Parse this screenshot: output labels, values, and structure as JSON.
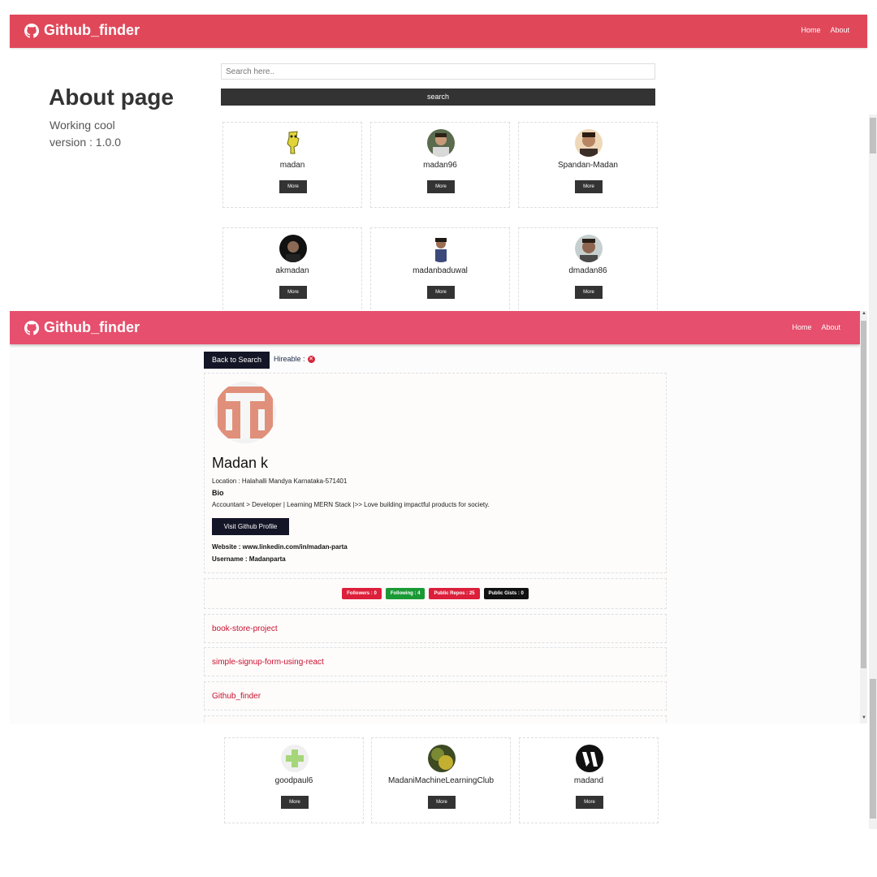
{
  "background_page": {
    "nav": {
      "brand": "Github_finder",
      "links": [
        "Home",
        "About"
      ]
    },
    "about": {
      "title": "About page",
      "line1": "Working cool",
      "line2": "version : 1.0.0"
    },
    "search": {
      "placeholder": "Search here..",
      "button": "search"
    },
    "users": [
      {
        "login": "madan",
        "more": "More"
      },
      {
        "login": "madan96",
        "more": "More"
      },
      {
        "login": "Spandan-Madan",
        "more": "More"
      },
      {
        "login": "akmadan",
        "more": "More"
      },
      {
        "login": "madanbaduwal",
        "more": "More"
      },
      {
        "login": "dmadan86",
        "more": "More"
      },
      {
        "login": "goodpaul6",
        "more": "More"
      },
      {
        "login": "MadaniMachineLearningClub",
        "more": "More"
      },
      {
        "login": "madand",
        "more": "More"
      }
    ]
  },
  "overlay_page": {
    "nav": {
      "brand": "Github_finder",
      "links": [
        "Home",
        "About"
      ]
    },
    "back_button": "Back to Search",
    "hireable": "Hireable :",
    "profile": {
      "name": "Madan k",
      "location": "Location : Halahalli Mandya Karnataka-571401",
      "bio_title": "Bio",
      "bio": "Accountant > Developer | Learning MERN Stack |>> Love building impactful products for society.",
      "visit_button": "Visit Github Profile",
      "website": "Website : www.linkedin.com/in/madan-parta",
      "username": "Username : Madanparta"
    },
    "stats": [
      {
        "label": "Followers : 0",
        "color": "#dc1f3a"
      },
      {
        "label": "Following : 4",
        "color": "#1a9a35"
      },
      {
        "label": "Public Repos : 25",
        "color": "#dc1f3a"
      },
      {
        "label": "Public Gists : 0",
        "color": "#111111"
      }
    ],
    "repos": [
      "book-store-project",
      "simple-signup-form-using-react",
      "Github_finder"
    ]
  },
  "colors": {
    "nav_bg": "#e0485a",
    "overlay_nav_bg": "#e64f6d",
    "dark_button": "#333333",
    "navy_button": "#141526",
    "repo_link": "#c8102e"
  },
  "icons": {
    "brand": "github-icon",
    "hireable": "x-circle-icon"
  }
}
